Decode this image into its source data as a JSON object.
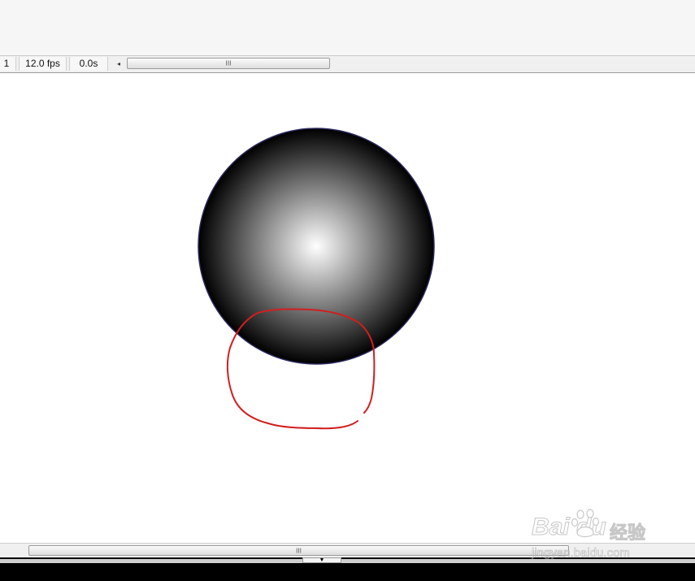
{
  "status_bar": {
    "frame": "1",
    "fps": "12.0 fps",
    "time": "0.0s",
    "left_arrow": "◂",
    "scroll_grip": "III"
  },
  "stage": {
    "sphere": {
      "gradient_center_color": "#ffffff",
      "gradient_edge_color": "#000000",
      "stroke_color": "#2b2a5e"
    },
    "annotation_color": "#d21e1e"
  },
  "bottom_scroll": {
    "grip": "III"
  },
  "bottom_strip": {
    "toggle_glyph": "▼"
  },
  "watermark": {
    "brand": "Bai  du",
    "jingyan": "经验",
    "url": "jingyan.baidu.com"
  }
}
